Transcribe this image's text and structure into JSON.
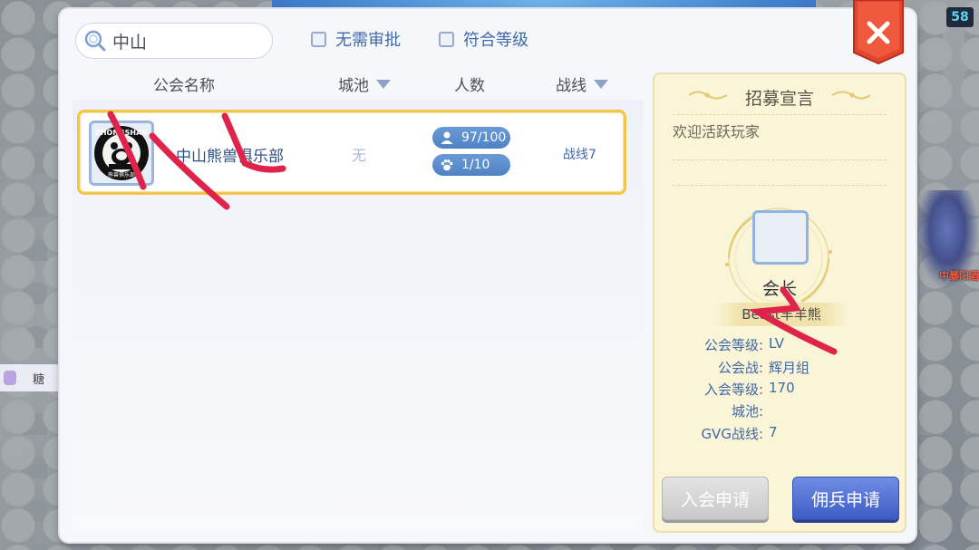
{
  "background": {
    "fps": "58",
    "left_chip_text": "糖",
    "side_label": "中暴阳酒"
  },
  "search": {
    "value": "中山"
  },
  "filters": [
    {
      "label": "无需审批"
    },
    {
      "label": "符合等级"
    }
  ],
  "table": {
    "headers": {
      "name": "公会名称",
      "city": "城池",
      "members": "人数",
      "battle_line": "战线"
    },
    "rows": [
      {
        "emblem_text": "ZHONGSHAN",
        "emblem_sub": "熊兽俱乐部",
        "name": "中山熊兽俱乐部",
        "city": "无",
        "members": "97/100",
        "pets": "1/10",
        "battle_line": "战线7"
      }
    ]
  },
  "card": {
    "title": "招募宣言",
    "declaration": "欢迎活跃玩家",
    "leader_title": "会长",
    "leader_name": "Beast羊羊熊",
    "info": {
      "guild_level_label": "公会等级:",
      "guild_level_value": "LV",
      "guild_war_label": "公会战:",
      "guild_war_value": "辉月组",
      "join_level_label": "入会等级:",
      "join_level_value": "170",
      "city_label": "城池:",
      "city_value": "",
      "gvg_label": "GVG战线:",
      "gvg_value": "7"
    },
    "join_button": "入会申请",
    "merc_button": "佣兵申请"
  },
  "colors": {
    "accent_blue": "#3e68a8",
    "highlight_border": "#f2c64a",
    "card_bg": "#fbf5d8",
    "close_red": "#e2452e",
    "button_blue": "#3d5cc3"
  }
}
